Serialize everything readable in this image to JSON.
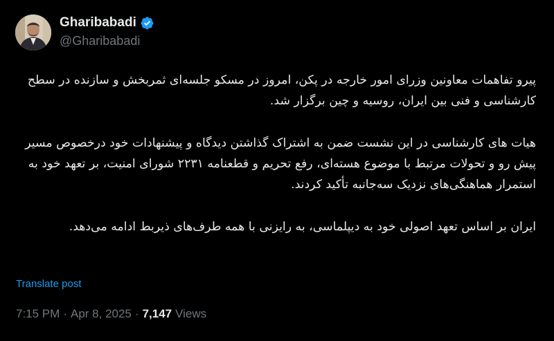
{
  "author": {
    "display_name": "Gharibabadi",
    "handle": "@Gharibabadi",
    "verified": true,
    "verified_color": "#1d9bf0"
  },
  "post": {
    "paragraphs": [
      "پیرو تفاهمات معاونین وزرای امور خارجه در پکن، امروز در مسکو جلسه‌ای ثمربخش و سازنده در سطح کارشناسی و فنی بین ایران، روسیه و چین برگزار شد.",
      "هیات های کارشناسی در این نشست ضمن به اشتراک گذاشتن دیدگاه و پیشنهادات خود درخصوص مسیر پیش رو و تحولات مرتبط با موضوع هسته‌ای، رفع تحریم و قطعنامه ۲۲۳۱ شورای امنیت، بر تعهد خود به استمرار هماهنگی‌های نزدیک سه‌جانبه تأکید کردند.",
      "ایران بر اساس تعهد اصولی خود به دیپلماسی، به رایزنی با همه طرف‌های ذیربط ادامه می‌دهد."
    ],
    "translate_label": "Translate post",
    "time": "7:15 PM",
    "separator": "·",
    "date": "Apr 8, 2025",
    "views_count": "7,147",
    "views_label": "Views"
  },
  "colors": {
    "background": "#000000",
    "text": "#e7e9ea",
    "secondary_text": "#71767b",
    "link": "#1d9bf0"
  },
  "icons": {
    "verified": "verified-badge-icon"
  }
}
